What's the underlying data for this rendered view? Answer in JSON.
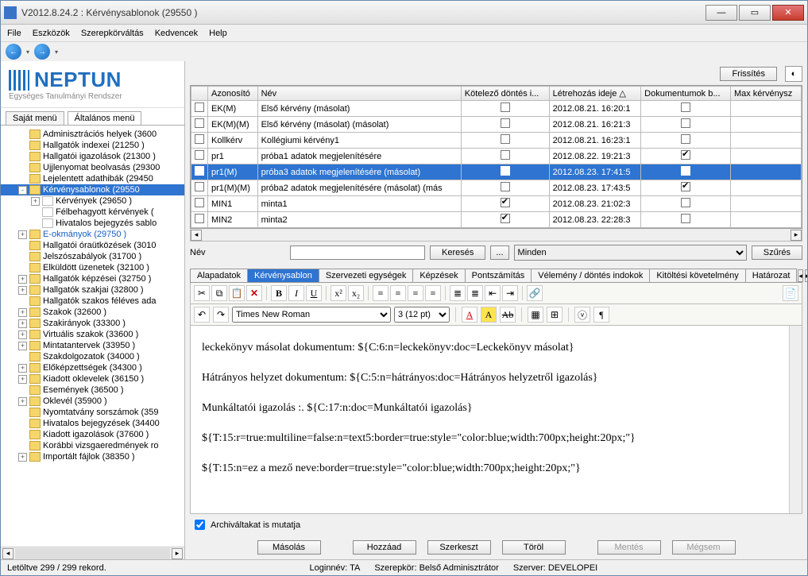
{
  "window": {
    "title": "V2012.8.24.2 : Kérvénysablonok (29550  )"
  },
  "menu": {
    "file": "File",
    "tools": "Eszközök",
    "role": "Szerepkörváltás",
    "fav": "Kedvencek",
    "help": "Help"
  },
  "logo": {
    "name": "NEPTUN",
    "sub": "Egységes Tanulmányi Rendszer"
  },
  "left_tabs": {
    "own": "Saját menü",
    "general": "Általános menü"
  },
  "tree": [
    {
      "lvl": 1,
      "exp": "",
      "label": "Adminisztrációs helyek (3600"
    },
    {
      "lvl": 1,
      "exp": "",
      "label": "Hallgatók indexei (21250  )"
    },
    {
      "lvl": 1,
      "exp": "",
      "label": "Hallgatói igazolások (21300  )"
    },
    {
      "lvl": 1,
      "exp": "",
      "label": "Ujjlenyomat beolvasás (29300"
    },
    {
      "lvl": 1,
      "exp": "",
      "label": "Lejelentett adathibák (29450"
    },
    {
      "lvl": 1,
      "exp": "-",
      "label": "Kérvénysablonok (29550",
      "sel": true,
      "blue": true
    },
    {
      "lvl": 2,
      "exp": "+",
      "label": "Kérvények (29650  )",
      "page": true
    },
    {
      "lvl": 2,
      "exp": "",
      "label": "Félbehagyott kérvények (",
      "page": true
    },
    {
      "lvl": 2,
      "exp": "",
      "label": "Hivatalos bejegyzés sablo",
      "page": true
    },
    {
      "lvl": 1,
      "exp": "+",
      "label": "E-okmányok (29750  )",
      "blue": true
    },
    {
      "lvl": 1,
      "exp": "",
      "label": "Hallgatói óraütközések (3010"
    },
    {
      "lvl": 1,
      "exp": "",
      "label": "Jelszószabályok (31700  )"
    },
    {
      "lvl": 1,
      "exp": "",
      "label": "Elküldött üzenetek (32100  )"
    },
    {
      "lvl": 1,
      "exp": "+",
      "label": "Hallgatók képzései (32750  )"
    },
    {
      "lvl": 1,
      "exp": "+",
      "label": "Hallgatók szakjai (32800  )"
    },
    {
      "lvl": 1,
      "exp": "",
      "label": "Hallgatók szakos féléves ada"
    },
    {
      "lvl": 1,
      "exp": "+",
      "label": "Szakok (32600  )"
    },
    {
      "lvl": 1,
      "exp": "+",
      "label": "Szakirányok (33300  )"
    },
    {
      "lvl": 1,
      "exp": "+",
      "label": "Virtuális szakok (33600  )"
    },
    {
      "lvl": 1,
      "exp": "+",
      "label": "Mintatantervek (33950  )"
    },
    {
      "lvl": 1,
      "exp": "",
      "label": "Szakdolgozatok (34000  )"
    },
    {
      "lvl": 1,
      "exp": "+",
      "label": "Előképzettségek (34300  )"
    },
    {
      "lvl": 1,
      "exp": "+",
      "label": "Kiadott oklevelek (36150  )"
    },
    {
      "lvl": 1,
      "exp": "",
      "label": "Események (36500  )"
    },
    {
      "lvl": 1,
      "exp": "+",
      "label": "Oklevél (35900  )"
    },
    {
      "lvl": 1,
      "exp": "",
      "label": "Nyomtatvány sorszámok (359"
    },
    {
      "lvl": 1,
      "exp": "",
      "label": "Hivatalos bejegyzések (34400"
    },
    {
      "lvl": 1,
      "exp": "",
      "label": "Kiadott igazolások (37600  )"
    },
    {
      "lvl": 1,
      "exp": "",
      "label": "Korábbi vizsgaeredmények ro"
    },
    {
      "lvl": 1,
      "exp": "+",
      "label": "Importált fájlok (38350  )"
    }
  ],
  "refresh_btn": "Frissítés",
  "grid": {
    "headers": {
      "id": "Azonosító",
      "name": "Név",
      "must": "Kötelező döntés i...",
      "created": "Létrehozás ideje",
      "docs": "Dokumentumok b...",
      "max": "Max kérvénysz"
    },
    "rows": [
      {
        "id": "EK(M)",
        "name": "Első kérvény (másolat)",
        "must": false,
        "created": "2012.08.21. 16:20:1",
        "docs": false
      },
      {
        "id": "EK(M)(M)",
        "name": "Első kérvény (másolat) (másolat)",
        "must": false,
        "created": "2012.08.21. 16:21:3",
        "docs": false
      },
      {
        "id": "Kollkérv",
        "name": "Kollégiumi kérvény1",
        "must": false,
        "created": "2012.08.21. 16:23:1",
        "docs": false
      },
      {
        "id": "pr1",
        "name": "próba1 adatok megjelenítésére",
        "must": false,
        "created": "2012.08.22. 19:21:3",
        "docs": true
      },
      {
        "id": "pr1(M)",
        "name": "próba3 adatok megjelenítésére (másolat)",
        "must": false,
        "created": "2012.08.23. 17:41:5",
        "docs": true,
        "sel": true
      },
      {
        "id": "pr1(M)(M)",
        "name": "próba2 adatok megjelenítésére (másolat) (más",
        "must": false,
        "created": "2012.08.23. 17:43:5",
        "docs": true
      },
      {
        "id": "MIN1",
        "name": "minta1",
        "must": true,
        "created": "2012.08.23. 21:02:3",
        "docs": false
      },
      {
        "id": "MIN2",
        "name": "minta2",
        "must": true,
        "created": "2012.08.23. 22:28:3",
        "docs": false
      }
    ]
  },
  "search": {
    "label": "Név",
    "btn": "Keresés",
    "dots": "...",
    "filter": "Minden",
    "filter_btn": "Szűrés"
  },
  "dtabs": [
    "Alapadatok",
    "Kérvénysablon",
    "Szervezeti egységek",
    "Képzések",
    "Pontszámítás",
    "Vélemény / döntés indokok",
    "Kitöltési követelmény",
    "Határozat"
  ],
  "dtab_active": 1,
  "font": {
    "family": "Times New Roman",
    "size": "3 (12 pt)"
  },
  "editor_lines": [
    "leckekönyv másolat dokumentum: ${C:6:n=leckekönyv:doc=Leckekönyv másolat}",
    "Hátrányos helyzet dokumentum: ${C:5:n=hátrányos:doc=Hátrányos helyzetről igazolás}",
    "Munkáltatói igazolás :. ${C:17:n:doc=Munkáltatói igazolás}",
    "${T:15:r=true:multiline=false:n=text5:border=true:style=\"color:blue;width:700px;height:20px;\"}",
    "${T:15:n=ez a mező neve:border=true:style=\"color:blue;width:700px;height:20px;\"}"
  ],
  "archive_label": "Archiváltakat is mutatja",
  "buttons": {
    "copy": "Másolás",
    "add": "Hozzáad",
    "edit": "Szerkeszt",
    "del": "Töröl",
    "save": "Mentés",
    "cancel": "Mégsem"
  },
  "status": {
    "left": "Letöltve 299 / 299 rekord.",
    "login": "Loginnév: TA",
    "role": "Szerepkör: Belső Adminisztrátor",
    "server": "Szerver: DEVELOPEI"
  }
}
